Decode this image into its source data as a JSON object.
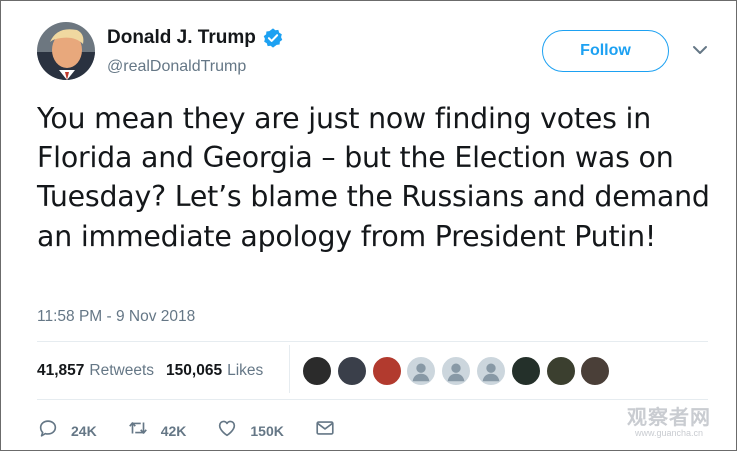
{
  "author": {
    "display_name": "Donald J. Trump",
    "handle": "@realDonaldTrump",
    "verified": true,
    "avatar_icon": "profile-photo"
  },
  "header": {
    "follow_label": "Follow",
    "menu_icon": "chevron-down-icon"
  },
  "tweet": {
    "text": "You mean they are just now finding votes in Florida and Georgia – but the Election was on Tuesday? Let’s blame the Russians and demand an immediate apology from President Putin!",
    "timestamp": "11:58 PM - 9 Nov 2018"
  },
  "stats": {
    "retweets_count": "41,857",
    "retweets_label": "Retweets",
    "likes_count": "150,065",
    "likes_label": "Likes"
  },
  "likers": [
    {
      "name": "liker-avatar-1",
      "color": "#2b2b2b"
    },
    {
      "name": "liker-avatar-2",
      "color": "#3a3f4a"
    },
    {
      "name": "liker-avatar-3",
      "color": "#b23a2e"
    },
    {
      "name": "liker-avatar-4",
      "color": "#ccd6dd"
    },
    {
      "name": "liker-avatar-5",
      "color": "#ccd6dd"
    },
    {
      "name": "liker-avatar-6",
      "color": "#ccd6dd"
    },
    {
      "name": "liker-avatar-7",
      "color": "#24302a"
    },
    {
      "name": "liker-avatar-8",
      "color": "#3b3f2f"
    },
    {
      "name": "liker-avatar-9",
      "color": "#4a3f38"
    }
  ],
  "actions": {
    "reply_count": "24K",
    "retweet_count": "42K",
    "like_count": "150K",
    "icons": [
      "reply-icon",
      "retweet-icon",
      "heart-icon",
      "message-icon"
    ]
  },
  "watermark": {
    "main": "观察者网",
    "sub": "www.guancha.cn"
  },
  "colors": {
    "accent": "#1da1f2",
    "text": "#14171a",
    "secondary": "#657786",
    "divider": "#e6ecf0"
  }
}
